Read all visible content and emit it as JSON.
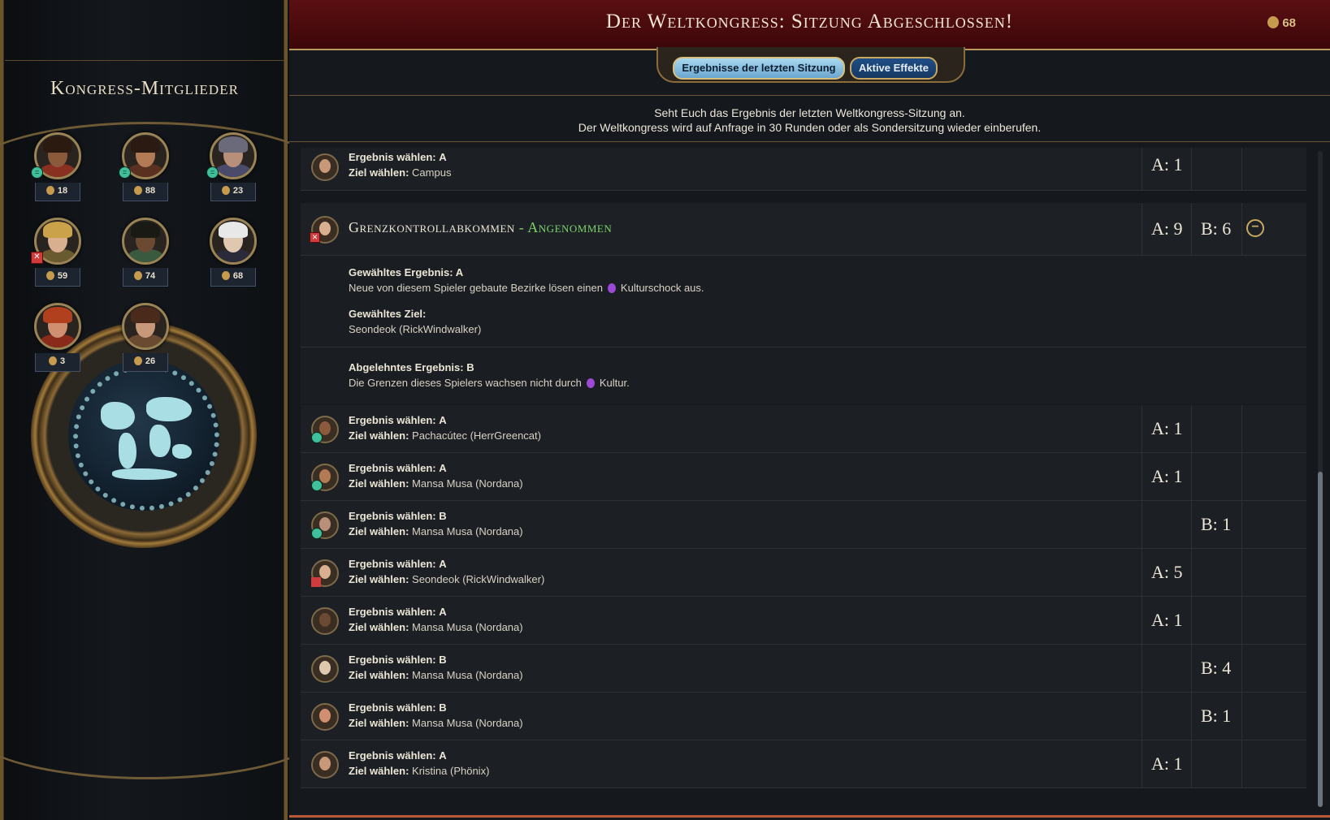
{
  "header": {
    "title": "Der Weltkongress: Sitzung Abgeschlossen!",
    "favor": "68",
    "favor_icon": "favor-icon"
  },
  "tabs": {
    "results": "Ergebnisse der letzten Sitzung",
    "effects": "Aktive Effekte"
  },
  "info": {
    "line1": "Seht Euch das Ergebnis der letzten Weltkongress-Sitzung an.",
    "line2": "Der Weltkongress wird auf Anfrage in 30 Runden oder als Sondersitzung wieder einberufen."
  },
  "sidebar": {
    "title": "Kongress-Mitglieder",
    "members": [
      {
        "favor": "18",
        "badge": "green",
        "skin": "#8a5a3a",
        "hair": "#2a1a10",
        "cloth": "#8a3020"
      },
      {
        "favor": "88",
        "badge": "green",
        "skin": "#b27a55",
        "hair": "#2a1a12",
        "cloth": "#5a3020"
      },
      {
        "favor": "23",
        "badge": "green",
        "skin": "#b8907a",
        "hair": "#6a6a7a",
        "cloth": "#4a4a6a"
      },
      {
        "favor": "59",
        "badge": "red",
        "skin": "#d8b090",
        "hair": "#caa24a",
        "cloth": "#6a5a30"
      },
      {
        "favor": "74",
        "badge": "",
        "skin": "#6a4a32",
        "hair": "#1a1a14",
        "cloth": "#3a5a40"
      },
      {
        "favor": "68",
        "badge": "",
        "skin": "#e0c8b0",
        "hair": "#e8e8e8",
        "cloth": "#2a2a3a"
      },
      {
        "favor": "3",
        "badge": "",
        "skin": "#d09070",
        "hair": "#b0401e",
        "cloth": "#8a2a1a"
      },
      {
        "favor": "26",
        "badge": "",
        "skin": "#c8987a",
        "hair": "#4a2a1a",
        "cloth": "#6a4a30"
      }
    ]
  },
  "labels": {
    "choose_outcome": "Ergebnis wählen:",
    "choose_target": "Ziel wählen:"
  },
  "first_row": {
    "outcome": "A",
    "target": "Campus",
    "vote_a": "A: 1",
    "vote_b": ""
  },
  "resolution": {
    "title": "Grenzkontrollabkommen",
    "separator": " - ",
    "status": "Angenommen",
    "vote_a": "A: 9",
    "vote_b": "B: 6",
    "chosen_outcome_label": "Gewähltes Ergebnis: A",
    "chosen_outcome_text_pre": "Neue von diesem Spieler gebaute Bezirke lösen einen",
    "chosen_outcome_text_post": "Kulturschock aus.",
    "chosen_target_label": "Gewähltes Ziel:",
    "chosen_target": "Seondeok (RickWindwalker)",
    "rejected_outcome_label": "Abgelehntes Ergebnis: B",
    "rejected_outcome_text_pre": "Die Grenzen dieses Spielers wachsen nicht durch",
    "rejected_outcome_text_post": "Kultur."
  },
  "votes": [
    {
      "outcome": "A",
      "target": "Pachacútec (HerrGreencat)",
      "vote_a": "A: 1",
      "vote_b": "",
      "skin": "#8a5a3a",
      "badge": "green"
    },
    {
      "outcome": "A",
      "target": "Mansa Musa (Nordana)",
      "vote_a": "A: 1",
      "vote_b": "",
      "skin": "#b27a55",
      "badge": "green"
    },
    {
      "outcome": "B",
      "target": "Mansa Musa (Nordana)",
      "vote_a": "",
      "vote_b": "B: 1",
      "skin": "#b8907a",
      "badge": "green"
    },
    {
      "outcome": "A",
      "target": "Seondeok (RickWindwalker)",
      "vote_a": "A: 5",
      "vote_b": "",
      "skin": "#d8b090",
      "badge": "red"
    },
    {
      "outcome": "A",
      "target": "Mansa Musa (Nordana)",
      "vote_a": "A: 1",
      "vote_b": "",
      "skin": "#6a4a32",
      "badge": ""
    },
    {
      "outcome": "B",
      "target": "Mansa Musa (Nordana)",
      "vote_a": "",
      "vote_b": "B: 4",
      "skin": "#e0c8b0",
      "badge": ""
    },
    {
      "outcome": "B",
      "target": "Mansa Musa (Nordana)",
      "vote_a": "",
      "vote_b": "B: 1",
      "skin": "#d09070",
      "badge": ""
    },
    {
      "outcome": "A",
      "target": "Kristina (Phönix)",
      "vote_a": "A: 1",
      "vote_b": "",
      "skin": "#c8987a",
      "badge": ""
    }
  ]
}
